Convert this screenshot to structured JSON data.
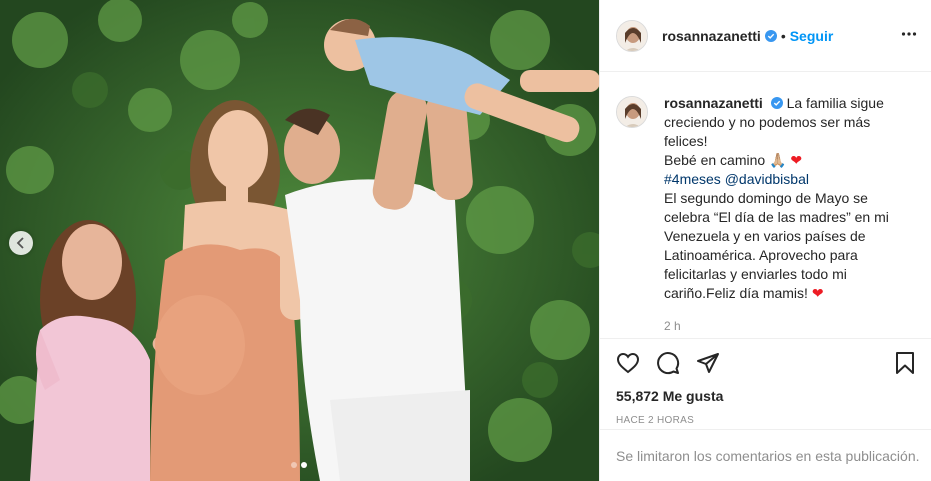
{
  "post": {
    "username": "rosannazanetti",
    "separator": "•",
    "follow_label": "Seguir",
    "caption": {
      "line1": "La familia sigue creciendo y no podemos ser más felices!",
      "line2": "Bebé en camino",
      "line2_emoji": "🙏🏼",
      "heart": "❤",
      "hashtag": "#4meses",
      "mention": "@davidbisbal",
      "body": "El segundo domingo de Mayo se celebra “El día de las madres” en mi Venezuela y en varios países de Latinoamérica. Aprovecho para felicitarlas y enviarles todo mi cariño.Feliz día mamis!"
    },
    "caption_time": "2 h",
    "likes": "55,872 Me gusta",
    "posted_ago": "HACE 2 HORAS",
    "comments_note": "Se limitaron los comentarios en esta publicación.",
    "carousel": {
      "total": 2,
      "active": 2
    }
  },
  "icons": {
    "verified": "verified-badge-icon",
    "more": "more-options-icon",
    "like": "heart-outline-icon",
    "comment": "comment-bubble-icon",
    "share": "paper-plane-icon",
    "save": "bookmark-icon",
    "prev": "chevron-left-icon"
  },
  "colors": {
    "accent": "#0095f6",
    "verified": "#3897f0",
    "link": "#00376b",
    "muted": "#8e8e8e",
    "heart": "#ed1c24"
  }
}
